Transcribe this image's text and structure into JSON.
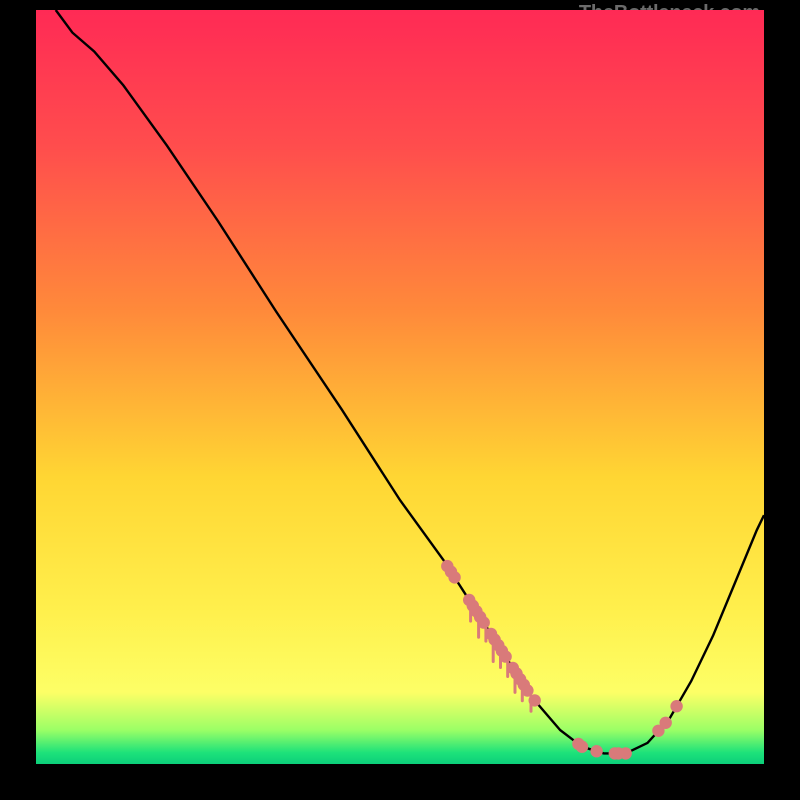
{
  "attribution": "TheBottleneck.com",
  "colors": {
    "background": "#000000",
    "curve_stroke": "#000000",
    "marker_fill": "#d97a7a",
    "gradient_stops": [
      {
        "offset": 0.0,
        "color": "#ff2a55"
      },
      {
        "offset": 0.18,
        "color": "#ff4d4d"
      },
      {
        "offset": 0.4,
        "color": "#ff8a3a"
      },
      {
        "offset": 0.62,
        "color": "#ffd633"
      },
      {
        "offset": 0.8,
        "color": "#fff04d"
      },
      {
        "offset": 0.905,
        "color": "#fdff66"
      },
      {
        "offset": 0.955,
        "color": "#9bff66"
      },
      {
        "offset": 0.985,
        "color": "#1de27a"
      },
      {
        "offset": 1.0,
        "color": "#0ccf7a"
      }
    ]
  },
  "chart_data": {
    "type": "line",
    "title": "",
    "xlabel": "",
    "ylabel": "",
    "xlim": [
      0,
      100
    ],
    "ylim": [
      0,
      100
    ],
    "curve_points": [
      {
        "x": 2.7,
        "y": 100
      },
      {
        "x": 5,
        "y": 97
      },
      {
        "x": 8,
        "y": 94.5
      },
      {
        "x": 12,
        "y": 90
      },
      {
        "x": 18,
        "y": 82
      },
      {
        "x": 25,
        "y": 72
      },
      {
        "x": 33,
        "y": 60
      },
      {
        "x": 42,
        "y": 47
      },
      {
        "x": 50,
        "y": 35
      },
      {
        "x": 56,
        "y": 27
      },
      {
        "x": 60,
        "y": 21
      },
      {
        "x": 64,
        "y": 15
      },
      {
        "x": 68,
        "y": 9
      },
      {
        "x": 72,
        "y": 4.5
      },
      {
        "x": 75,
        "y": 2.3
      },
      {
        "x": 78,
        "y": 1.4
      },
      {
        "x": 81,
        "y": 1.4
      },
      {
        "x": 84,
        "y": 2.8
      },
      {
        "x": 87,
        "y": 6
      },
      {
        "x": 90,
        "y": 11
      },
      {
        "x": 93,
        "y": 17
      },
      {
        "x": 96,
        "y": 24
      },
      {
        "x": 99,
        "y": 31
      },
      {
        "x": 100,
        "y": 33
      }
    ],
    "markers": [
      {
        "x": 56.5,
        "y": 42
      },
      {
        "x": 57.0,
        "y": 40.5
      },
      {
        "x": 57.5,
        "y": 39.5
      },
      {
        "x": 59.5,
        "y": 36
      },
      {
        "x": 60.0,
        "y": 35
      },
      {
        "x": 60.5,
        "y": 34
      },
      {
        "x": 61.0,
        "y": 33
      },
      {
        "x": 61.5,
        "y": 32
      },
      {
        "x": 62.5,
        "y": 30.5
      },
      {
        "x": 63.0,
        "y": 29.5
      },
      {
        "x": 63.5,
        "y": 28.5
      },
      {
        "x": 64.0,
        "y": 27.5
      },
      {
        "x": 64.5,
        "y": 26.5
      },
      {
        "x": 65.5,
        "y": 25
      },
      {
        "x": 66.0,
        "y": 24
      },
      {
        "x": 66.5,
        "y": 23
      },
      {
        "x": 67.0,
        "y": 22
      },
      {
        "x": 67.5,
        "y": 21
      },
      {
        "x": 68.5,
        "y": 19.5
      },
      {
        "x": 74.5,
        "y": 4.5
      },
      {
        "x": 75.0,
        "y": 4.0
      },
      {
        "x": 77.0,
        "y": 2.2
      },
      {
        "x": 79.5,
        "y": 1.6
      },
      {
        "x": 80.0,
        "y": 1.6
      },
      {
        "x": 81.0,
        "y": 1.6
      },
      {
        "x": 85.5,
        "y": 8.5
      },
      {
        "x": 86.5,
        "y": 11.5
      },
      {
        "x": 88.0,
        "y": 15.5
      }
    ],
    "marker_spikes": [
      {
        "x": 59.7,
        "len": 2.5
      },
      {
        "x": 60.8,
        "len": 3.0
      },
      {
        "x": 61.8,
        "len": 2.0
      },
      {
        "x": 62.8,
        "len": 3.2
      },
      {
        "x": 63.8,
        "len": 2.5
      },
      {
        "x": 64.8,
        "len": 2.2
      },
      {
        "x": 65.8,
        "len": 2.8
      },
      {
        "x": 66.8,
        "len": 2.4
      },
      {
        "x": 68.0,
        "len": 2.0
      }
    ]
  }
}
